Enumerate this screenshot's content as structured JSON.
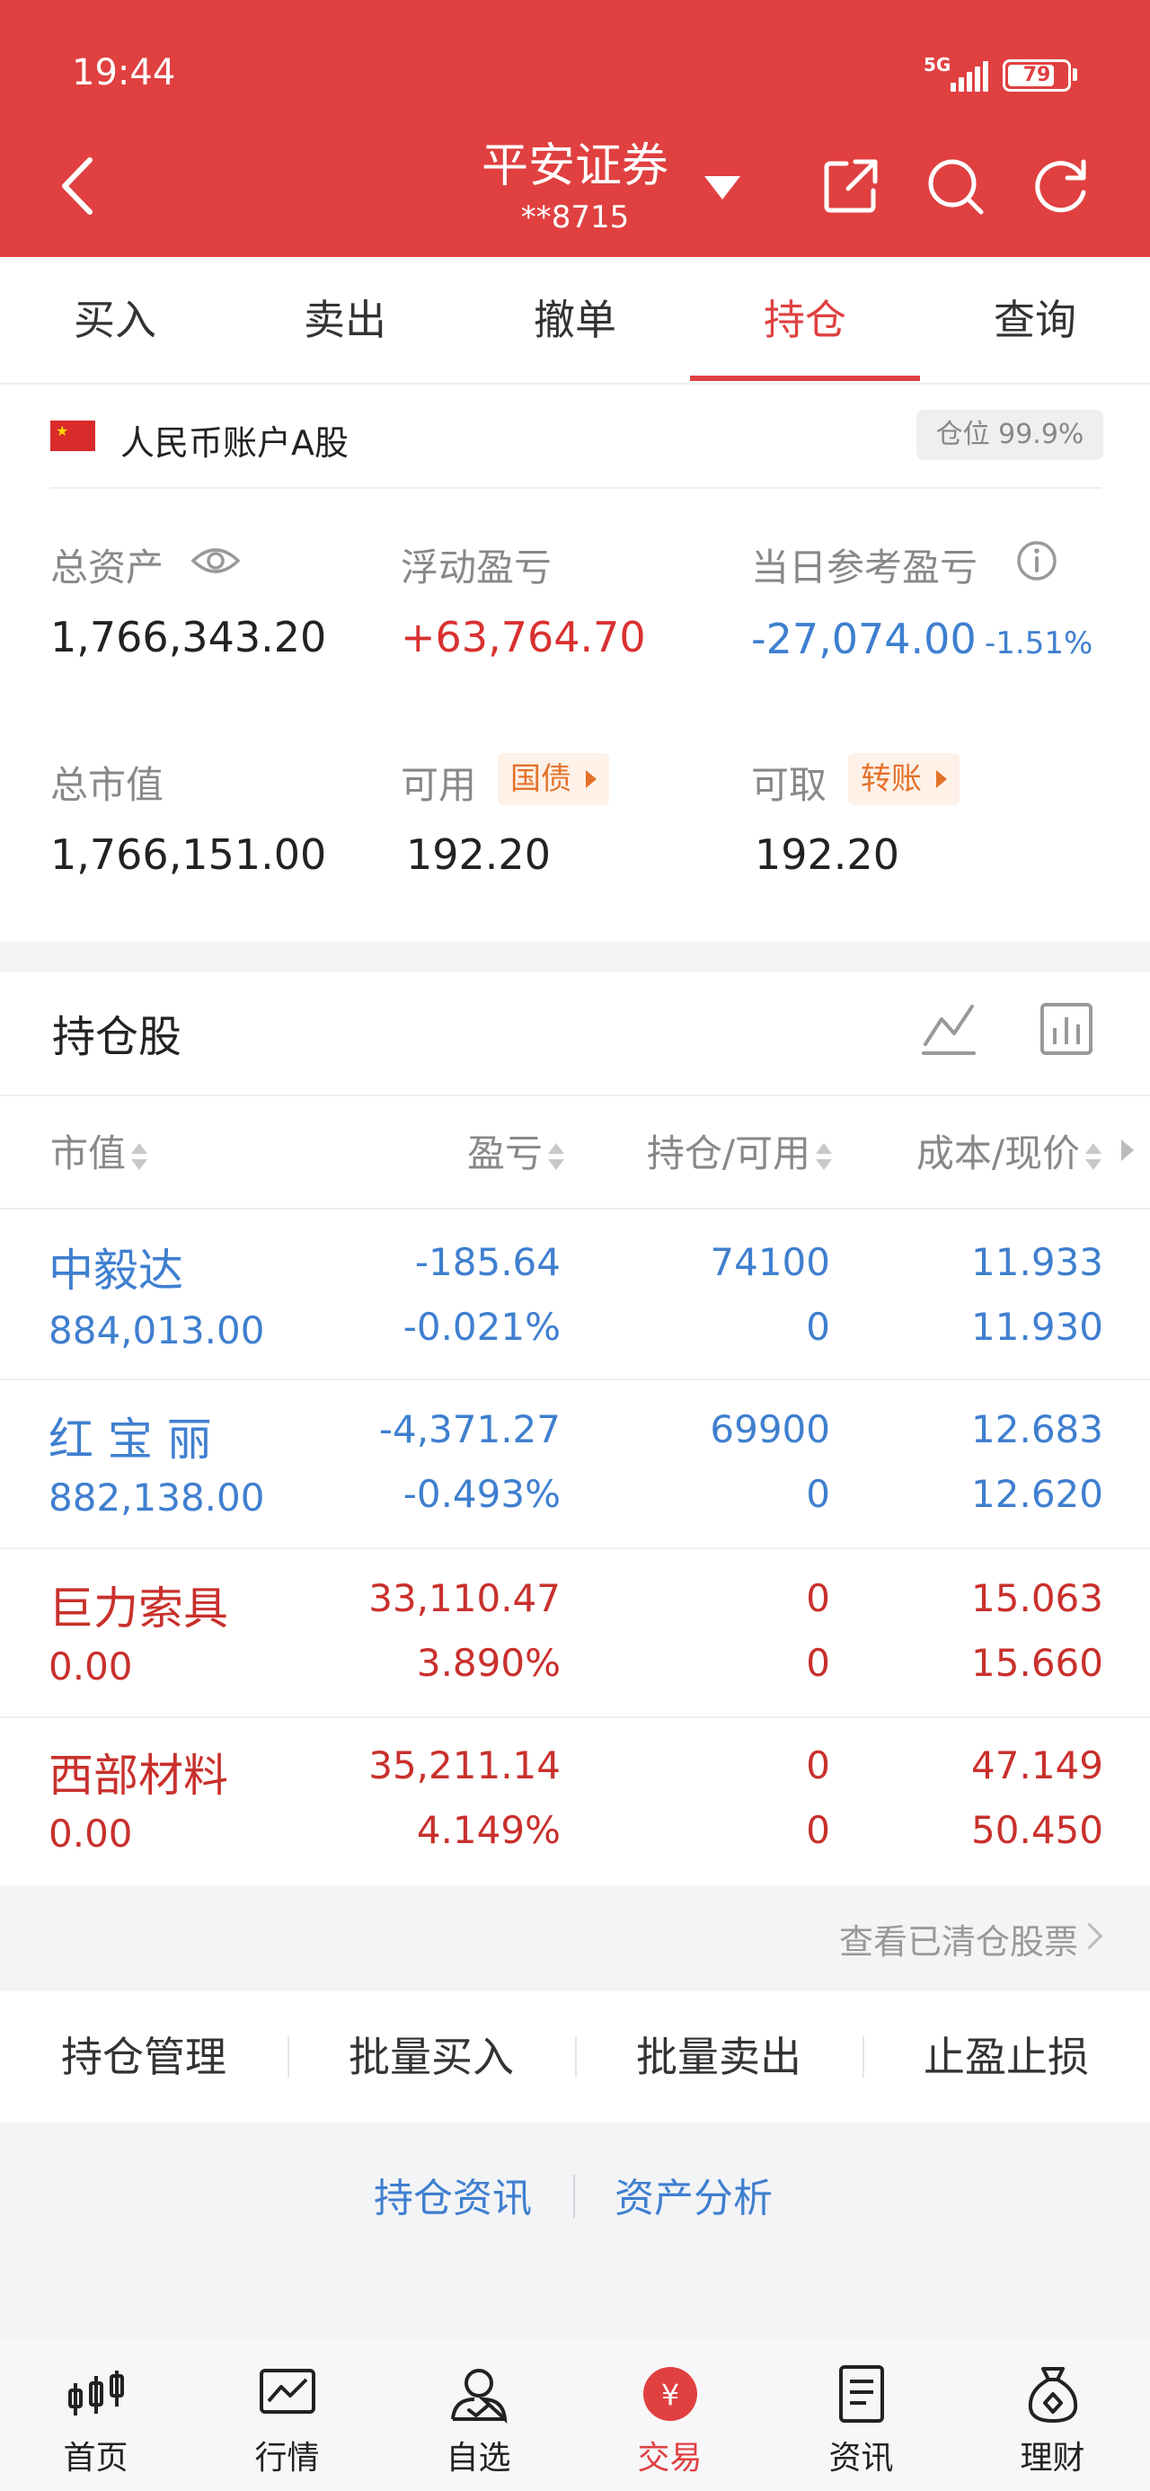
{
  "status": {
    "time": "19:44",
    "network": "5G",
    "battery": "79",
    "battery_level": 0.79
  },
  "header": {
    "broker": "平安证券",
    "account": "**8715"
  },
  "tabs": [
    "买入",
    "卖出",
    "撤单",
    "持仓",
    "查询"
  ],
  "active_tab": "持仓",
  "account": {
    "label": "人民币账户A股",
    "position_ratio": "仓位 99.9%"
  },
  "summary": {
    "total_assets_label": "总资产",
    "total_assets": "1,766,343.20",
    "float_pl_label": "浮动盈亏",
    "float_pl": "+63,764.70",
    "day_pl_label": "当日参考盈亏",
    "day_pl": "-27,074.00",
    "day_pl_pct": "-1.51%",
    "market_value_label": "总市值",
    "market_value": "1,766,151.00",
    "available_label": "可用",
    "available_tag": "国债",
    "available": "192.20",
    "withdrawable_label": "可取",
    "withdrawable_tag": "转账",
    "withdrawable": "192.20"
  },
  "holdings": {
    "title": "持仓股",
    "columns": [
      "市值",
      "盈亏",
      "持仓/可用",
      "成本/现价"
    ],
    "rows": [
      {
        "name": "中毅达",
        "market_value": "884,013.00",
        "pl": "-185.64",
        "pl_pct": "-0.021%",
        "position": "74100",
        "available": "0",
        "cost": "11.933",
        "price": "11.930",
        "color": "#3f7fcf"
      },
      {
        "name": "红 宝 丽",
        "market_value": "882,138.00",
        "pl": "-4,371.27",
        "pl_pct": "-0.493%",
        "position": "69900",
        "available": "0",
        "cost": "12.683",
        "price": "12.620",
        "color": "#3f7fcf"
      },
      {
        "name": "巨力索具",
        "market_value": "0.00",
        "pl": "33,110.47",
        "pl_pct": "3.890%",
        "position": "0",
        "available": "0",
        "cost": "15.063",
        "price": "15.660",
        "color": "#c9302c"
      },
      {
        "name": "西部材料",
        "market_value": "0.00",
        "pl": "35,211.14",
        "pl_pct": "4.149%",
        "position": "0",
        "available": "0",
        "cost": "47.149",
        "price": "50.450",
        "color": "#c9302c"
      }
    ],
    "cleared_link": "查看已清仓股票"
  },
  "actions": [
    "持仓管理",
    "批量买入",
    "批量卖出",
    "止盈止损"
  ],
  "links": [
    "持仓资讯",
    "资产分析"
  ],
  "tabbar": [
    {
      "label": "首页",
      "icon": "candlestick-icon"
    },
    {
      "label": "行情",
      "icon": "chart-icon"
    },
    {
      "label": "自选",
      "icon": "user-check-icon"
    },
    {
      "label": "交易",
      "icon": "yuan-icon"
    },
    {
      "label": "资讯",
      "icon": "document-icon"
    },
    {
      "label": "理财",
      "icon": "money-bag-icon"
    }
  ],
  "active_tabbar": "交易",
  "colors": {
    "brand_red": "#e04040",
    "gain_red": "#c9302c",
    "loss_blue": "#3f7fcf",
    "tag_orange": "#e4722a"
  }
}
